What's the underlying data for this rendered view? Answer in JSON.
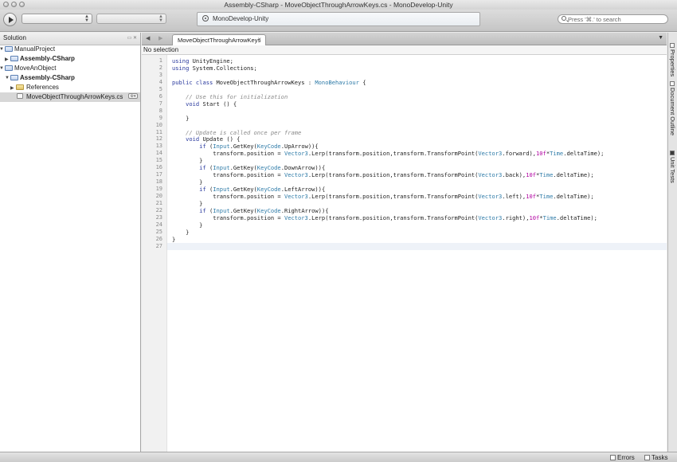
{
  "window": {
    "title": "Assembly-CSharp - MoveObjectThroughArrowKeys.cs - MonoDevelop-Unity"
  },
  "toolbar": {
    "config_combo": "",
    "target_combo": "",
    "status_text": "MonoDevelop-Unity",
    "search_placeholder": "Press '⌘.' to search"
  },
  "solution": {
    "title": "Solution",
    "items": [
      {
        "label": "ManualProject",
        "bold": false
      },
      {
        "label": "Assembly-CSharp",
        "bold": true
      },
      {
        "label": "MoveAnObject",
        "bold": false
      },
      {
        "label": "Assembly-CSharp",
        "bold": true
      },
      {
        "label": "References",
        "bold": false
      },
      {
        "label": "MoveObjectThroughArrowKeys.cs",
        "bold": false
      }
    ]
  },
  "editor": {
    "tab_label": "MoveObjectThroughArrowKeys",
    "nav_selection": "No selection",
    "current_line": 27,
    "lines": [
      "using UnityEngine;",
      "using System.Collections;",
      "",
      "public class MoveObjectThroughArrowKeys : MonoBehaviour {",
      "",
      "    // Use this for initialization",
      "    void Start () {",
      "",
      "    }",
      "",
      "    // Update is called once per frame",
      "    void Update () {",
      "        if (Input.GetKey(KeyCode.UpArrow)){",
      "            transform.position = Vector3.Lerp(transform.position,transform.TransformPoint(Vector3.forward),10f*Time.deltaTime);",
      "        }",
      "        if (Input.GetKey(KeyCode.DownArrow)){",
      "            transform.position = Vector3.Lerp(transform.position,transform.TransformPoint(Vector3.back),10f*Time.deltaTime);",
      "        }",
      "        if (Input.GetKey(KeyCode.LeftArrow)){",
      "            transform.position = Vector3.Lerp(transform.position,transform.TransformPoint(Vector3.left),10f*Time.deltaTime);",
      "        }",
      "        if (Input.GetKey(KeyCode.RightArrow)){",
      "            transform.position = Vector3.Lerp(transform.position,transform.TransformPoint(Vector3.right),10f*Time.deltaTime);",
      "        }",
      "    }",
      "}",
      ""
    ]
  },
  "right_dock": {
    "tabs": [
      "Properties",
      "Document Outline",
      "Unit Tests"
    ]
  },
  "statusbar": {
    "errors_label": "Errors",
    "tasks_label": "Tasks"
  },
  "colors": {
    "keyword": "#2a3a9e",
    "type": "#2e7ba8",
    "comment": "#8a8a8a",
    "number": "#b000a0"
  }
}
